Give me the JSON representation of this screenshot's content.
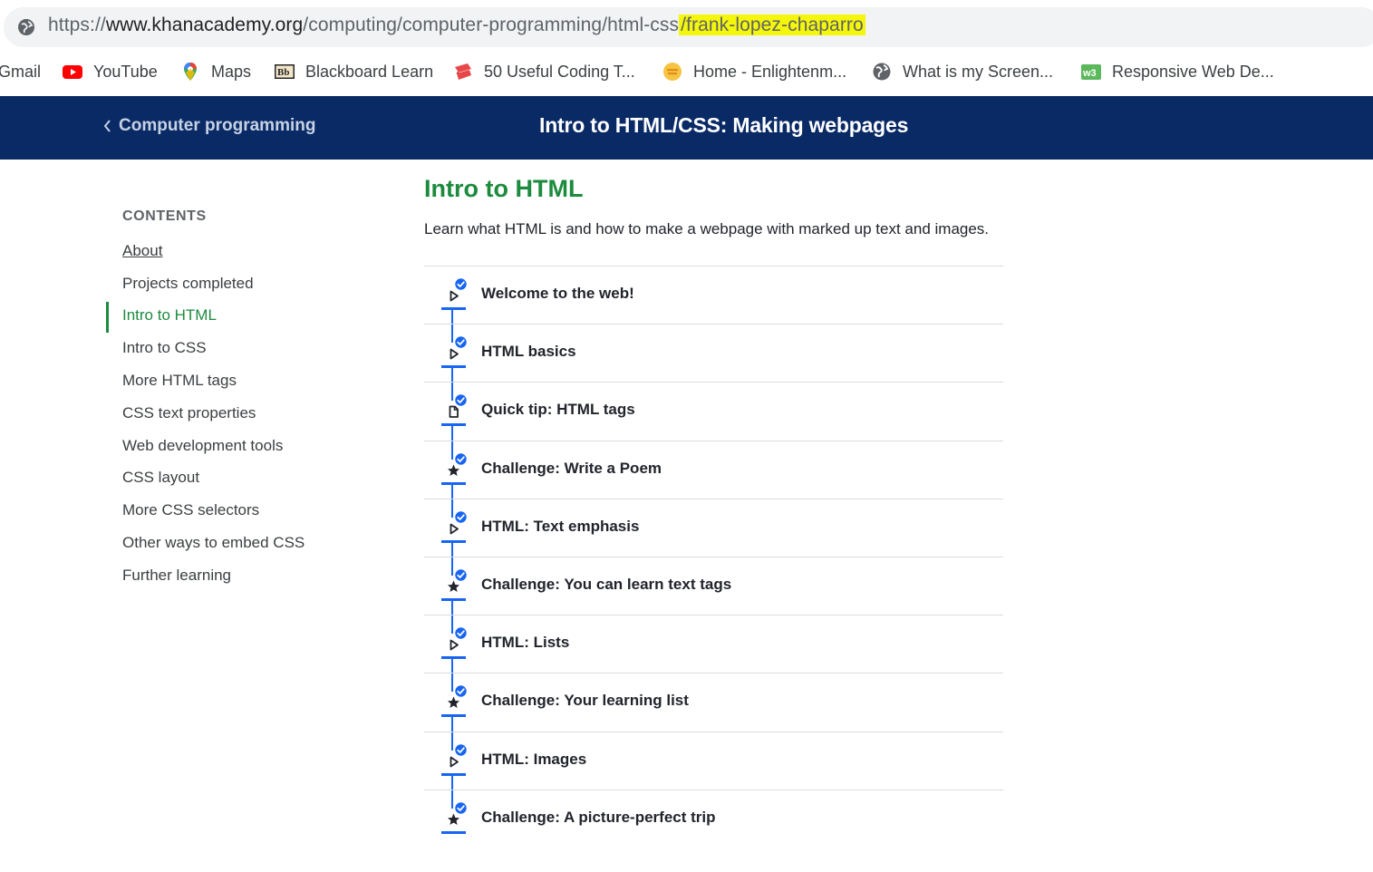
{
  "browser": {
    "url_scheme": "https://",
    "url_domain": "www.khanacademy.org",
    "url_path": "/computing/computer-programming/html-css",
    "url_highlight": "/frank-lopez-chaparro",
    "highlight_color": "#f5f70a"
  },
  "bookmarks": [
    {
      "label": "Gmail",
      "icon": "gmail-icon"
    },
    {
      "label": "YouTube",
      "icon": "youtube-icon"
    },
    {
      "label": "Maps",
      "icon": "maps-icon"
    },
    {
      "label": "Blackboard Learn",
      "icon": "blackboard-icon"
    },
    {
      "label": "50 Useful Coding T...",
      "icon": "coding-icon"
    },
    {
      "label": "Home - Enlightenm...",
      "icon": "enlightenment-icon"
    },
    {
      "label": "What is my Screen...",
      "icon": "globe-icon"
    },
    {
      "label": "Responsive Web De...",
      "icon": "w3-icon"
    }
  ],
  "header": {
    "back_label": "Computer programming",
    "title": "Intro to HTML/CSS: Making webpages",
    "bg_color": "#0a2a66"
  },
  "sidebar": {
    "heading": "CONTENTS",
    "items": [
      {
        "label": "About"
      },
      {
        "label": "Projects completed"
      },
      {
        "label": "Intro to HTML"
      },
      {
        "label": "Intro to CSS"
      },
      {
        "label": "More HTML tags"
      },
      {
        "label": "CSS text properties"
      },
      {
        "label": "Web development tools"
      },
      {
        "label": "CSS layout"
      },
      {
        "label": "More CSS selectors"
      },
      {
        "label": "Other ways to embed CSS"
      },
      {
        "label": "Further learning"
      }
    ],
    "active_index": 2,
    "accent_color": "#1c8b3e"
  },
  "main": {
    "title": "Intro to HTML",
    "description": "Learn what HTML is and how to make a webpage with marked up text and images.",
    "lessons": [
      {
        "title": "Welcome to the web!",
        "type": "video",
        "completed": true
      },
      {
        "title": "HTML basics",
        "type": "video",
        "completed": true
      },
      {
        "title": "Quick tip: HTML tags",
        "type": "article",
        "completed": true
      },
      {
        "title": "Challenge: Write a Poem",
        "type": "challenge",
        "completed": true
      },
      {
        "title": "HTML: Text emphasis",
        "type": "video",
        "completed": true
      },
      {
        "title": "Challenge: You can learn text tags",
        "type": "challenge",
        "completed": true
      },
      {
        "title": "HTML: Lists",
        "type": "video",
        "completed": true
      },
      {
        "title": "Challenge: Your learning list",
        "type": "challenge",
        "completed": true
      },
      {
        "title": "HTML: Images",
        "type": "video",
        "completed": true
      },
      {
        "title": "Challenge: A picture-perfect trip",
        "type": "challenge",
        "completed": true
      }
    ],
    "progress_color": "#1865f2"
  }
}
